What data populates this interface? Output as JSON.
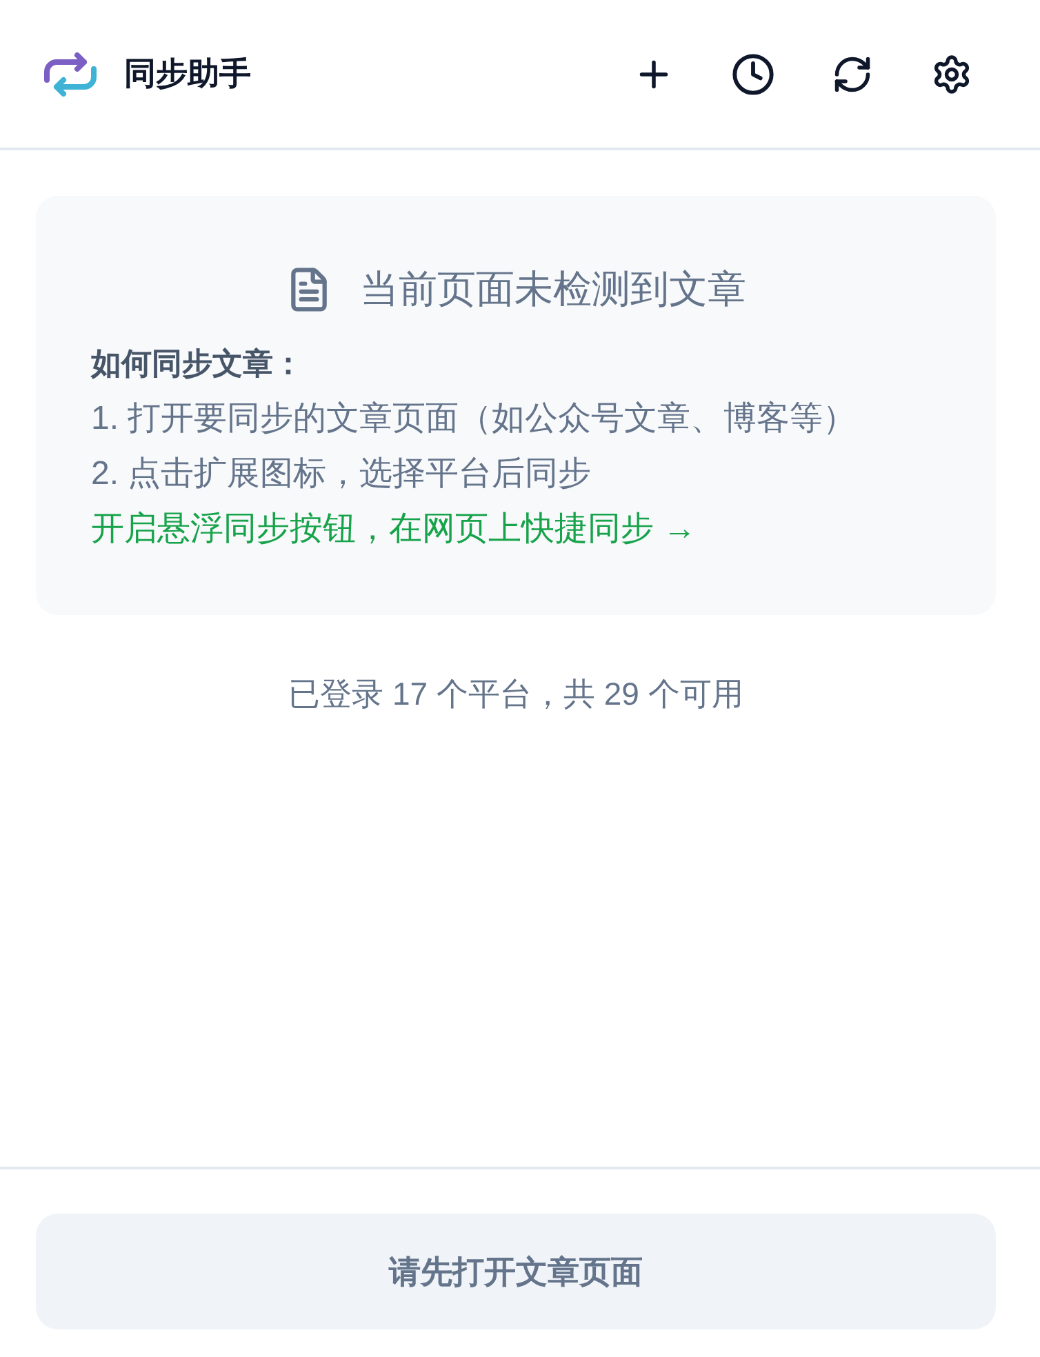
{
  "header": {
    "title": "同步助手"
  },
  "notice": {
    "title": "当前页面未检测到文章",
    "steps_heading": "如何同步文章：",
    "steps": [
      "1. 打开要同步的文章页面（如公众号文章、博客等）",
      "2. 点击扩展图标，选择平台后同步"
    ],
    "link": "开启悬浮同步按钮，在网页上快捷同步 →"
  },
  "platform_summary": "已登录 17 个平台，共 29 个可用",
  "footer_button": {
    "label": "请先打开文章页面",
    "disabled": true
  }
}
